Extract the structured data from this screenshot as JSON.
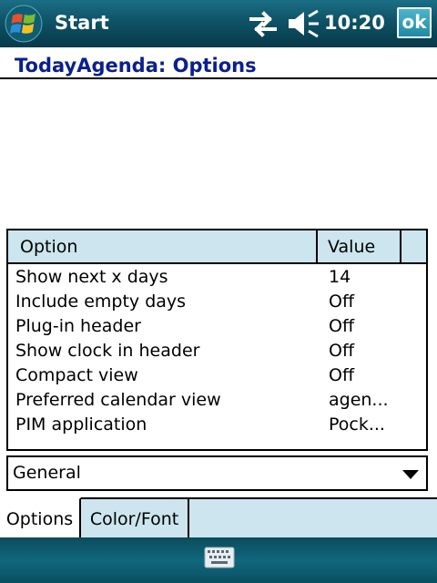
{
  "titlebar": {
    "start_label": "Start",
    "clock": "10:20",
    "ok_label": "ok",
    "icons": [
      "windows-logo",
      "connectivity-icon",
      "volume-muted-icon"
    ]
  },
  "page": {
    "title": "TodayAgenda: Options"
  },
  "list": {
    "columns": [
      "Option",
      "Value",
      ""
    ],
    "rows": [
      {
        "name": "Show next x days",
        "value": "14"
      },
      {
        "name": "Include empty days",
        "value": "Off"
      },
      {
        "name": "Plug-in header",
        "value": "Off"
      },
      {
        "name": "Show clock in header",
        "value": "Off"
      },
      {
        "name": "Compact view",
        "value": "Off"
      },
      {
        "name": "Preferred calendar view",
        "value": "agen..."
      },
      {
        "name": "PIM application",
        "value": "Pock..."
      }
    ]
  },
  "category": {
    "selected": "General"
  },
  "tabs": [
    {
      "label": "Options",
      "active": true
    },
    {
      "label": "Color/Font",
      "active": false
    }
  ],
  "menubar": {
    "icons": [
      "keyboard-icon"
    ]
  },
  "colors": {
    "titlebar": "#0e5266",
    "title_text": "#0a1f8f",
    "header_bg": "#cce5ee",
    "ok_button": "#2f9ab6"
  }
}
